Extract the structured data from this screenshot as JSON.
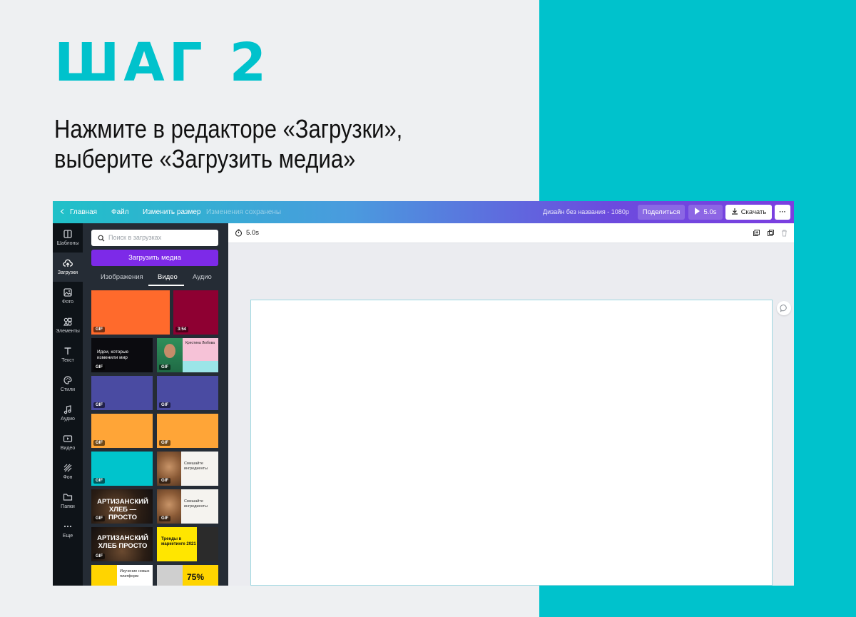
{
  "page": {
    "step_title": "ШАГ 2",
    "description_line1": "Нажмите в редакторе «Загрузки»,",
    "description_line2": "выберите «Загрузить медиа»"
  },
  "colors": {
    "teal": "#00c2cc",
    "purple_button": "#7d2ae8",
    "panel_bg": "#252c35",
    "nav_bg": "#0e1318"
  },
  "topbar": {
    "back_label": "Главная",
    "file_label": "Файл",
    "resize_label": "Изменить размер",
    "saved_status": "Изменения сохранены",
    "design_title": "Дизайн без названия - 1080р",
    "share_label": "Поделиться",
    "play_duration": "5.0s",
    "download_label": "Скачать",
    "more_label": "···"
  },
  "sidebar": {
    "items": [
      {
        "label": "Шаблоны",
        "icon": "templates-icon"
      },
      {
        "label": "Загрузки",
        "icon": "upload-cloud-icon"
      },
      {
        "label": "Фото",
        "icon": "photo-icon"
      },
      {
        "label": "Элементы",
        "icon": "elements-icon"
      },
      {
        "label": "Текст",
        "icon": "text-icon"
      },
      {
        "label": "Стили",
        "icon": "palette-icon"
      },
      {
        "label": "Аудио",
        "icon": "music-icon"
      },
      {
        "label": "Видео",
        "icon": "video-icon"
      },
      {
        "label": "Фон",
        "icon": "background-icon"
      },
      {
        "label": "Папки",
        "icon": "folder-icon"
      },
      {
        "label": "Еще",
        "icon": "more-icon"
      }
    ]
  },
  "panel": {
    "search_placeholder": "Поиск в загрузках",
    "upload_button": "Загрузить медиа",
    "tabs": [
      "Изображения",
      "Видео",
      "Аудио"
    ],
    "active_tab": "Видео",
    "gif_badge": "GIF",
    "video_duration": "3:54",
    "thumb_texts": {
      "ideas": "Идеи, которые изменили мир",
      "pink_card": "Крестина Любова",
      "mix1": "Смешайте ингредиенты",
      "mix2": "Смешайте ингредиенты",
      "bread1": "АРТИЗАНСКИЙ ХЛЕБ — ПРОСТО",
      "bread2": "АРТИЗАНСКИЙ ХЛЕБ ПРОСТО",
      "trends": "Тренды в маркетинге 2021",
      "study": "Изучение новых платформ",
      "percent": "75%"
    }
  },
  "editor": {
    "duration": "5.0s"
  }
}
